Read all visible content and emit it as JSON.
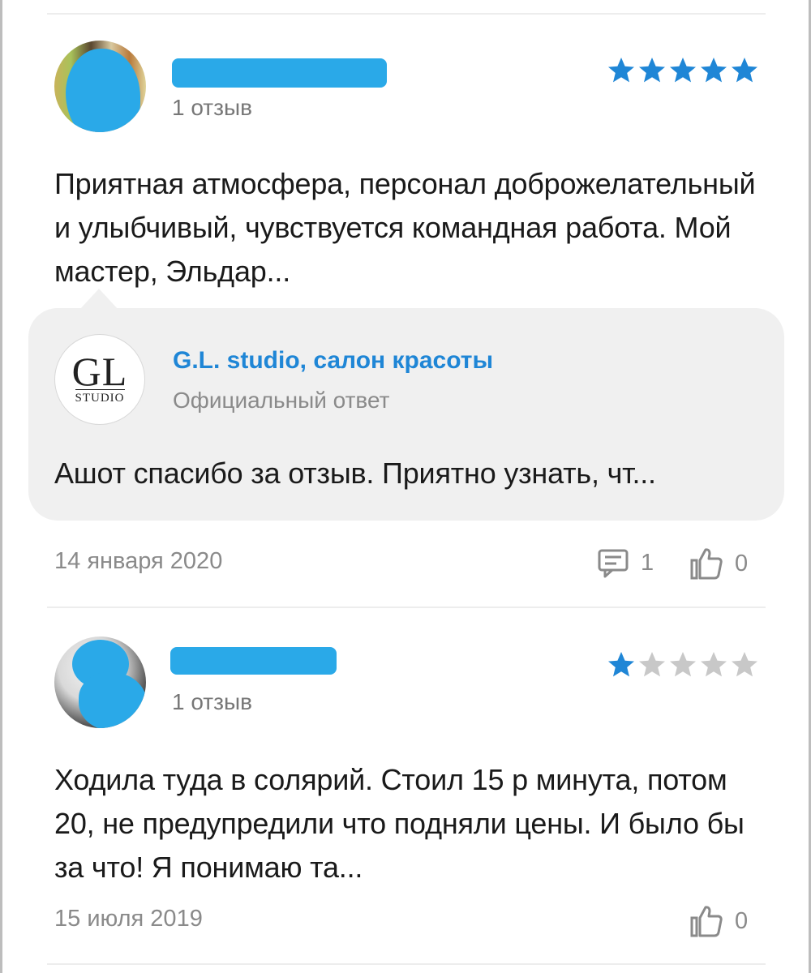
{
  "reviews": [
    {
      "count_label": "1 отзыв",
      "rating": 5,
      "text": "Приятная атмосфера, персонал доброжелательный и улыбчивый, чувствуется командная работа. Мой мастер, Эльдар...",
      "reply": {
        "logo_main": "GL",
        "logo_sub": "STUDIO",
        "org_name": "G.L. studio, салон красоты",
        "org_subtitle": "Официальный ответ",
        "text": "Ашот спасибо за отзыв. Приятно узнать, чт..."
      },
      "date": "14 января 2020",
      "comments_count": "1",
      "likes_count": "0"
    },
    {
      "count_label": "1 отзыв",
      "rating": 1,
      "text": "Ходила туда в солярий. Стоил 15 р минута, потом 20, не предупредили что подняли цены. И было бы за что! Я понимаю та...",
      "date": "15 июля 2019",
      "likes_count": "0"
    }
  ],
  "colors": {
    "star_filled": "#1f86d6",
    "star_empty": "#c8c8c8",
    "redaction": "#2aa9e8",
    "muted_text": "#8a8a8a",
    "reply_bg": "#f0f0f0"
  },
  "icons": {
    "comment": "comment-icon",
    "like": "thumbs-up-icon"
  }
}
